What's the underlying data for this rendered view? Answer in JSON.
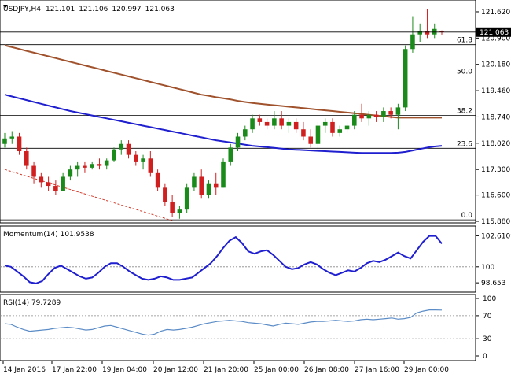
{
  "chart_data": [
    {
      "type": "candlestick",
      "title": "USDJPY,H4",
      "ohlc_header": [
        "121.101",
        "121.106",
        "120.997",
        "121.063"
      ],
      "ylim": [
        115.88,
        121.9
      ],
      "y_ticks": [
        "121.620",
        "120.900",
        "120.180",
        "119.460",
        "118.740",
        "118.020",
        "117.300",
        "116.600",
        "115.880"
      ],
      "current_price": "121.063",
      "x_tick_labels": [
        "14 Jan 2016",
        "17 Jan 22:00",
        "19 Jan 04:00",
        "20 Jan 12:00",
        "21 Jan 20:00",
        "25 Jan 00:00",
        "26 Jan 08:00",
        "27 Jan 16:00",
        "29 Jan 00:00"
      ],
      "fibonacci": [
        {
          "label": "61.8",
          "value": 120.72
        },
        {
          "label": "50.0",
          "value": 119.86
        },
        {
          "label": "38.2",
          "value": 118.78
        },
        {
          "label": "23.6",
          "value": 117.88
        },
        {
          "label": "0.0",
          "value": 115.92
        }
      ],
      "candles": [
        [
          118.0,
          118.3,
          117.9,
          118.15
        ],
        [
          118.15,
          118.35,
          118.0,
          118.2
        ],
        [
          118.2,
          118.3,
          117.7,
          117.8
        ],
        [
          117.8,
          117.9,
          117.3,
          117.4
        ],
        [
          117.4,
          117.5,
          116.9,
          117.1
        ],
        [
          117.1,
          117.2,
          116.8,
          116.95
        ],
        [
          116.95,
          117.1,
          116.7,
          116.85
        ],
        [
          116.85,
          117.0,
          116.6,
          116.7
        ],
        [
          116.7,
          117.2,
          116.7,
          117.1
        ],
        [
          117.1,
          117.4,
          117.0,
          117.3
        ],
        [
          117.3,
          117.5,
          117.1,
          117.4
        ],
        [
          117.4,
          117.5,
          117.2,
          117.35
        ],
        [
          117.35,
          117.5,
          117.3,
          117.45
        ],
        [
          117.45,
          117.6,
          117.3,
          117.4
        ],
        [
          117.4,
          117.6,
          117.3,
          117.55
        ],
        [
          117.55,
          117.9,
          117.5,
          117.85
        ],
        [
          117.85,
          118.1,
          117.7,
          118.0
        ],
        [
          118.0,
          118.1,
          117.6,
          117.7
        ],
        [
          117.7,
          117.8,
          117.4,
          117.5
        ],
        [
          117.5,
          117.7,
          117.3,
          117.6
        ],
        [
          117.6,
          117.8,
          117.1,
          117.2
        ],
        [
          117.2,
          117.3,
          116.7,
          116.8
        ],
        [
          116.8,
          116.9,
          116.3,
          116.4
        ],
        [
          116.4,
          116.6,
          116.0,
          116.1
        ],
        [
          116.1,
          116.3,
          115.95,
          116.2
        ],
        [
          116.2,
          116.9,
          116.1,
          116.8
        ],
        [
          116.8,
          117.2,
          116.7,
          117.1
        ],
        [
          117.1,
          117.3,
          116.5,
          116.6
        ],
        [
          116.6,
          117.0,
          116.5,
          116.9
        ],
        [
          116.9,
          117.2,
          116.6,
          116.8
        ],
        [
          116.8,
          117.6,
          116.8,
          117.5
        ],
        [
          117.5,
          118.0,
          117.4,
          117.9
        ],
        [
          117.9,
          118.3,
          117.8,
          118.2
        ],
        [
          118.2,
          118.5,
          118.1,
          118.4
        ],
        [
          118.4,
          118.8,
          118.3,
          118.7
        ],
        [
          118.7,
          118.8,
          118.5,
          118.6
        ],
        [
          118.6,
          118.7,
          118.4,
          118.5
        ],
        [
          118.5,
          118.9,
          118.4,
          118.7
        ],
        [
          118.7,
          118.9,
          118.4,
          118.5
        ],
        [
          118.5,
          118.7,
          118.3,
          118.6
        ],
        [
          118.6,
          118.7,
          118.3,
          118.4
        ],
        [
          118.4,
          118.6,
          118.1,
          118.2
        ],
        [
          118.2,
          118.4,
          117.9,
          118.0
        ],
        [
          118.0,
          118.6,
          117.8,
          118.5
        ],
        [
          118.5,
          118.7,
          118.3,
          118.6
        ],
        [
          118.6,
          118.7,
          118.2,
          118.3
        ],
        [
          118.3,
          118.5,
          118.2,
          118.4
        ],
        [
          118.4,
          118.6,
          118.3,
          118.5
        ],
        [
          118.5,
          118.9,
          118.4,
          118.8
        ],
        [
          118.8,
          119.1,
          118.6,
          118.7
        ],
        [
          118.7,
          118.9,
          118.5,
          118.8
        ],
        [
          118.8,
          118.9,
          118.6,
          118.75
        ],
        [
          118.75,
          119.0,
          118.6,
          118.9
        ],
        [
          118.9,
          119.0,
          118.7,
          118.8
        ],
        [
          118.8,
          119.1,
          118.4,
          119.0
        ],
        [
          119.0,
          120.7,
          118.9,
          120.6
        ],
        [
          120.6,
          121.5,
          120.5,
          121.0
        ],
        [
          121.0,
          121.3,
          120.8,
          121.1
        ],
        [
          121.1,
          121.7,
          120.9,
          121.0
        ],
        [
          121.0,
          121.3,
          120.9,
          121.15
        ],
        [
          121.101,
          121.106,
          120.997,
          121.063
        ]
      ],
      "ma_slow": [
        120.7,
        120.65,
        120.6,
        120.55,
        120.5,
        120.45,
        120.4,
        120.35,
        120.3,
        120.25,
        120.2,
        120.15,
        120.1,
        120.05,
        120.0,
        119.95,
        119.9,
        119.85,
        119.8,
        119.75,
        119.7,
        119.65,
        119.6,
        119.55,
        119.5,
        119.45,
        119.4,
        119.35,
        119.32,
        119.28,
        119.25,
        119.22,
        119.18,
        119.15,
        119.12,
        119.1,
        119.08,
        119.06,
        119.04,
        119.02,
        119.0,
        118.98,
        118.96,
        118.94,
        118.92,
        118.9,
        118.88,
        118.86,
        118.84,
        118.82,
        118.8,
        118.78,
        118.76,
        118.74,
        118.72,
        118.72,
        118.72,
        118.72,
        118.72,
        118.72,
        118.72
      ],
      "ma_fast": [
        119.35,
        119.3,
        119.25,
        119.2,
        119.15,
        119.1,
        119.05,
        119.0,
        118.95,
        118.9,
        118.86,
        118.82,
        118.78,
        118.74,
        118.7,
        118.66,
        118.62,
        118.58,
        118.54,
        118.5,
        118.46,
        118.42,
        118.38,
        118.34,
        118.3,
        118.26,
        118.22,
        118.18,
        118.14,
        118.1,
        118.07,
        118.04,
        118.01,
        117.98,
        117.95,
        117.93,
        117.91,
        117.89,
        117.87,
        117.85,
        117.84,
        117.83,
        117.82,
        117.81,
        117.8,
        117.79,
        117.78,
        117.77,
        117.76,
        117.75,
        117.75,
        117.75,
        117.75,
        117.75,
        117.76,
        117.78,
        117.82,
        117.86,
        117.9,
        117.93,
        117.95
      ],
      "trend_line": {
        "from": [
          0,
          117.3
        ],
        "to": [
          23,
          115.9
        ]
      }
    },
    {
      "type": "line",
      "title": "Momentum(14) 101.9538",
      "ylim": [
        98.0,
        103.3
      ],
      "y_ticks": [
        "102.6109",
        "100",
        "98.653"
      ],
      "reference_lines": [
        100
      ],
      "values": [
        100.1,
        100.0,
        99.6,
        99.2,
        98.7,
        98.6,
        98.8,
        99.4,
        99.9,
        100.1,
        99.8,
        99.5,
        99.2,
        99.0,
        99.1,
        99.5,
        100.0,
        100.3,
        100.3,
        100.0,
        99.6,
        99.3,
        99.0,
        98.9,
        99.0,
        99.2,
        99.1,
        98.9,
        98.9,
        99.0,
        99.1,
        99.5,
        99.9,
        100.3,
        100.9,
        101.6,
        102.2,
        102.5,
        102.0,
        101.3,
        101.1,
        101.3,
        101.4,
        101.0,
        100.5,
        100.0,
        99.8,
        99.9,
        100.2,
        100.4,
        100.2,
        99.8,
        99.5,
        99.3,
        99.5,
        99.7,
        99.6,
        99.9,
        100.3,
        100.5,
        100.4,
        100.6,
        100.9,
        101.2,
        100.9,
        100.7,
        101.4,
        102.1,
        102.6,
        102.6,
        101.95
      ]
    },
    {
      "type": "line",
      "title": "RSI(14) 79.7289",
      "ylim": [
        0,
        100
      ],
      "y_ticks": [
        "100",
        "70",
        "30",
        "0"
      ],
      "reference_lines": [
        70,
        30
      ],
      "values": [
        56,
        55,
        50,
        46,
        43,
        44,
        45,
        46,
        48,
        49,
        50,
        49,
        47,
        45,
        46,
        49,
        52,
        53,
        50,
        47,
        44,
        41,
        38,
        36,
        38,
        43,
        46,
        45,
        46,
        48,
        50,
        53,
        56,
        58,
        60,
        61,
        62,
        61,
        60,
        58,
        57,
        56,
        54,
        52,
        55,
        57,
        56,
        55,
        57,
        59,
        60,
        60,
        61,
        62,
        61,
        60,
        61,
        63,
        64,
        63,
        64,
        65,
        66,
        64,
        65,
        67,
        75,
        78,
        80,
        80,
        79.7
      ]
    }
  ]
}
